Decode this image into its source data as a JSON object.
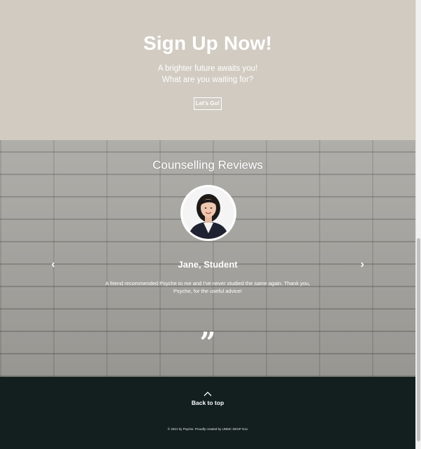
{
  "signup": {
    "title": "Sign Up Now!",
    "subtitle_line1": "A brighter future awaits you!",
    "subtitle_line2": "What are you waiting for?",
    "cta_label": "Let's Go!"
  },
  "reviews": {
    "title": "Counselling Reviews",
    "reviewer_name": "Jane, Student",
    "review_text": "A friend recommended Psyche to me and I've never studied the same again. Thank you, Psyche, for the useful advice!",
    "prev_arrow": "‹",
    "next_arrow": "›",
    "quote_mark": "”"
  },
  "footer": {
    "back_to_top_label": "Back to top",
    "copyright": "© 2021 by Psyche. Proudly created by UNMC SEGP G11"
  },
  "colors": {
    "signup_bg": "#d1cbc1",
    "footer_bg": "#121f1e",
    "text": "#ffffff"
  }
}
